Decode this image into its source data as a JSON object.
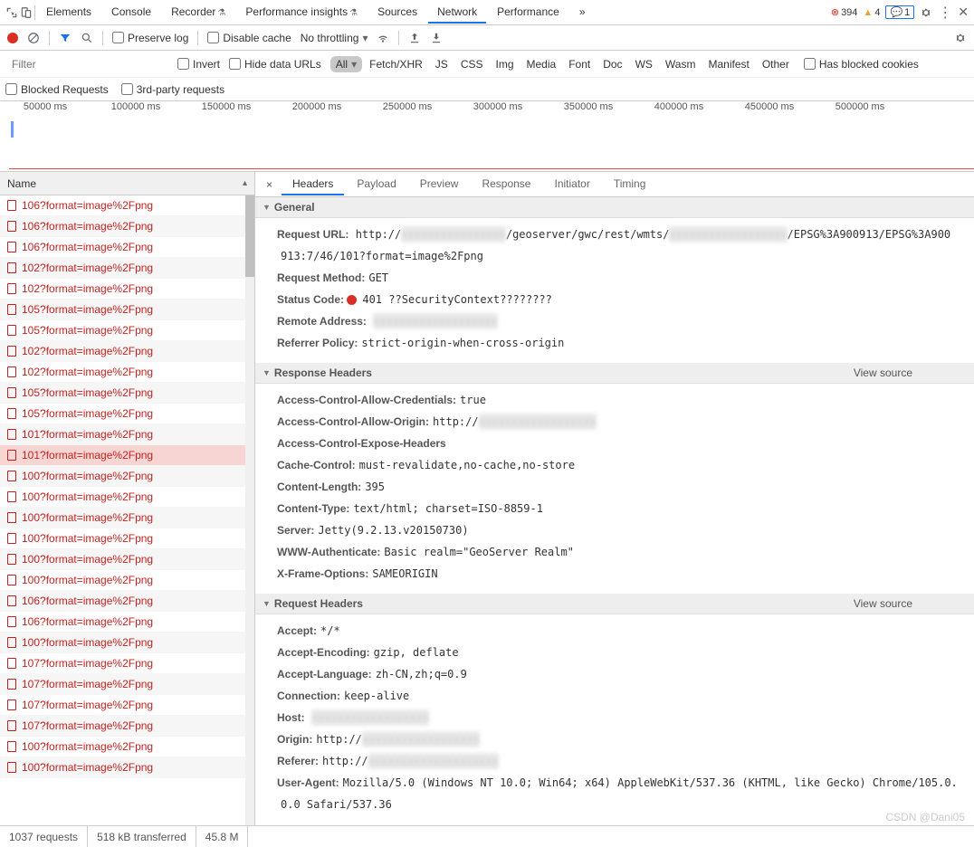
{
  "top": {
    "tabs": [
      "Elements",
      "Console",
      "Recorder",
      "Performance insights",
      "Sources",
      "Network",
      "Performance"
    ],
    "active": "Network",
    "more": "»",
    "errors": "394",
    "warnings": "4",
    "messages": "1"
  },
  "toolbar": {
    "preserve_log": "Preserve log",
    "disable_cache": "Disable cache",
    "throttle": "No throttling"
  },
  "filter": {
    "placeholder": "Filter",
    "invert": "Invert",
    "hide_data": "Hide data URLs",
    "types": [
      "All",
      "Fetch/XHR",
      "JS",
      "CSS",
      "Img",
      "Media",
      "Font",
      "Doc",
      "WS",
      "Wasm",
      "Manifest",
      "Other"
    ],
    "selected_type": "All",
    "blocked_cookies": "Has blocked cookies",
    "blocked_requests": "Blocked Requests",
    "third_party": "3rd-party requests"
  },
  "timeline": {
    "ticks": [
      "50000 ms",
      "100000 ms",
      "150000 ms",
      "200000 ms",
      "250000 ms",
      "300000 ms",
      "350000 ms",
      "400000 ms",
      "450000 ms",
      "500000 ms"
    ]
  },
  "left": {
    "header": "Name",
    "items": [
      "106?format=image%2Fpng",
      "106?format=image%2Fpng",
      "106?format=image%2Fpng",
      "102?format=image%2Fpng",
      "102?format=image%2Fpng",
      "105?format=image%2Fpng",
      "105?format=image%2Fpng",
      "102?format=image%2Fpng",
      "102?format=image%2Fpng",
      "105?format=image%2Fpng",
      "105?format=image%2Fpng",
      "101?format=image%2Fpng",
      "101?format=image%2Fpng",
      "100?format=image%2Fpng",
      "100?format=image%2Fpng",
      "100?format=image%2Fpng",
      "100?format=image%2Fpng",
      "100?format=image%2Fpng",
      "100?format=image%2Fpng",
      "106?format=image%2Fpng",
      "106?format=image%2Fpng",
      "100?format=image%2Fpng",
      "107?format=image%2Fpng",
      "107?format=image%2Fpng",
      "107?format=image%2Fpng",
      "107?format=image%2Fpng",
      "100?format=image%2Fpng",
      "100?format=image%2Fpng"
    ],
    "selected_index": 12
  },
  "detail_tabs": {
    "tabs": [
      "Headers",
      "Payload",
      "Preview",
      "Response",
      "Initiator",
      "Timing"
    ],
    "active": "Headers"
  },
  "general": {
    "title": "General",
    "request_url_k": "Request URL:",
    "url_pre": "http://",
    "url_mid": "/geoserver/gwc/rest/wmts/",
    "url_end": "/EPSG%3A900913/EPSG%3A900",
    "url_line2": "913:7/46/101?format=image%2Fpng",
    "method_k": "Request Method:",
    "method_v": "GET",
    "status_k": "Status Code:",
    "status_v": "401 ??SecurityContext????????",
    "remote_k": "Remote Address:",
    "referrer_k": "Referrer Policy:",
    "referrer_v": "strict-origin-when-cross-origin"
  },
  "response": {
    "title": "Response Headers",
    "view_source": "View source",
    "ac_cred_k": "Access-Control-Allow-Credentials:",
    "ac_cred_v": "true",
    "ac_origin_k": "Access-Control-Allow-Origin:",
    "ac_origin_v": "http://",
    "ac_expose_k": "Access-Control-Expose-Headers",
    "cache_k": "Cache-Control:",
    "cache_v": "must-revalidate,no-cache,no-store",
    "clen_k": "Content-Length:",
    "clen_v": "395",
    "ctype_k": "Content-Type:",
    "ctype_v": "text/html; charset=ISO-8859-1",
    "server_k": "Server:",
    "server_v": "Jetty(9.2.13.v20150730)",
    "www_k": "WWW-Authenticate:",
    "www_v": "Basic realm=\"GeoServer Realm\"",
    "xframe_k": "X-Frame-Options:",
    "xframe_v": "SAMEORIGIN"
  },
  "request": {
    "title": "Request Headers",
    "view_source": "View source",
    "accept_k": "Accept:",
    "accept_v": "*/*",
    "enc_k": "Accept-Encoding:",
    "enc_v": "gzip, deflate",
    "lang_k": "Accept-Language:",
    "lang_v": "zh-CN,zh;q=0.9",
    "conn_k": "Connection:",
    "conn_v": "keep-alive",
    "host_k": "Host:",
    "origin_k": "Origin:",
    "origin_v": "http://",
    "referer_k": "Referer:",
    "referer_v": "http://",
    "ua_k": "User-Agent:",
    "ua_v": "Mozilla/5.0 (Windows NT 10.0; Win64; x64) AppleWebKit/537.36 (KHTML, like Gecko) Chrome/105.0.",
    "ua_v2": "0.0 Safari/537.36"
  },
  "footer": {
    "requests": "1037 requests",
    "transferred": "518 kB transferred",
    "resources": "45.8 M"
  },
  "watermark": "CSDN @Dani05"
}
